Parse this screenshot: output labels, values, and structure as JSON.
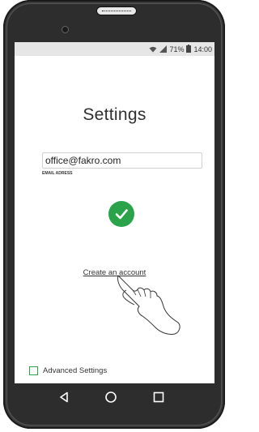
{
  "status_bar": {
    "battery_percent": "71%",
    "time": "14:00",
    "icons": [
      "wifi-icon",
      "signal-icon",
      "battery-icon"
    ]
  },
  "settings": {
    "title": "Settings",
    "email_value": "office@fakro.com",
    "email_label": "EMAIL ADRESS",
    "create_account_label": "Create an account",
    "advanced_settings_label": "Advanced Settings",
    "advanced_checked": false
  },
  "navigation": {
    "icons": [
      "back-icon",
      "home-icon",
      "recents-icon"
    ]
  },
  "colors": {
    "accent": "#2aa34a",
    "phone_body": "#2d2d2d",
    "status_bar": "#e6e6e6"
  }
}
